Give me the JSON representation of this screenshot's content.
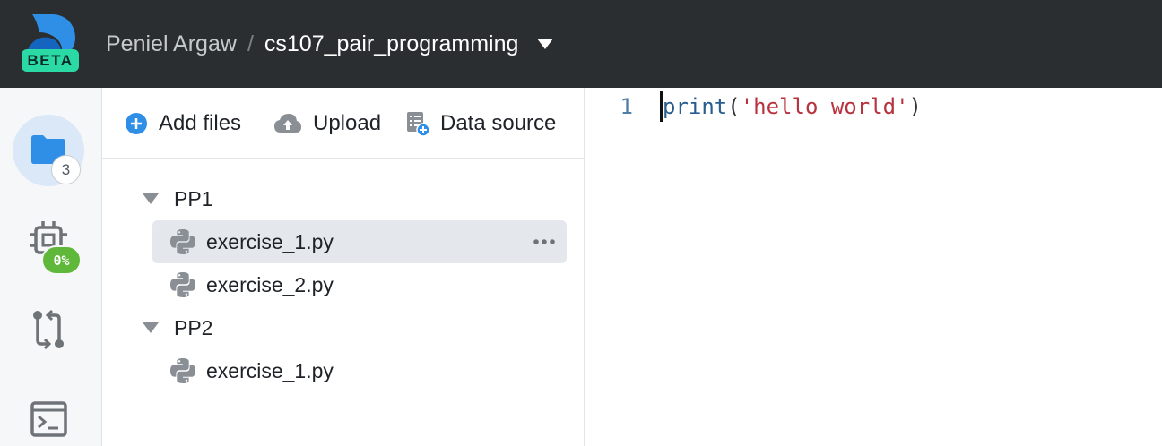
{
  "topbar": {
    "badge": "BETA",
    "user": "Peniel Argaw",
    "separator": "/",
    "project": "cs107_pair_programming",
    "icons": [
      "logo-icon",
      "chevron-down-icon"
    ]
  },
  "activitybar": {
    "files_badge": "3",
    "checks_badge": "0%",
    "icons": [
      "folder-icon",
      "chip-icon",
      "git-compare-icon",
      "terminal-icon"
    ]
  },
  "file_actions": {
    "add_files": "Add files",
    "upload": "Upload",
    "data_source": "Data source"
  },
  "tree": {
    "folders": [
      {
        "name": "PP1",
        "expanded": true,
        "files": [
          {
            "name": "exercise_1.py",
            "active": true
          },
          {
            "name": "exercise_2.py",
            "active": false
          }
        ]
      },
      {
        "name": "PP2",
        "expanded": true,
        "files": [
          {
            "name": "exercise_1.py",
            "active": false
          }
        ]
      }
    ]
  },
  "editor": {
    "line_number": "1",
    "code": {
      "fn": "print",
      "open": "(",
      "string": "'hello world'",
      "close": ")"
    }
  },
  "colors": {
    "topbar": "#2b2e31",
    "beta_badge": "#2bd9a4",
    "accent_blue": "#2f8ee5",
    "progress_green": "#5fb83a",
    "string_red": "#b8333f"
  }
}
